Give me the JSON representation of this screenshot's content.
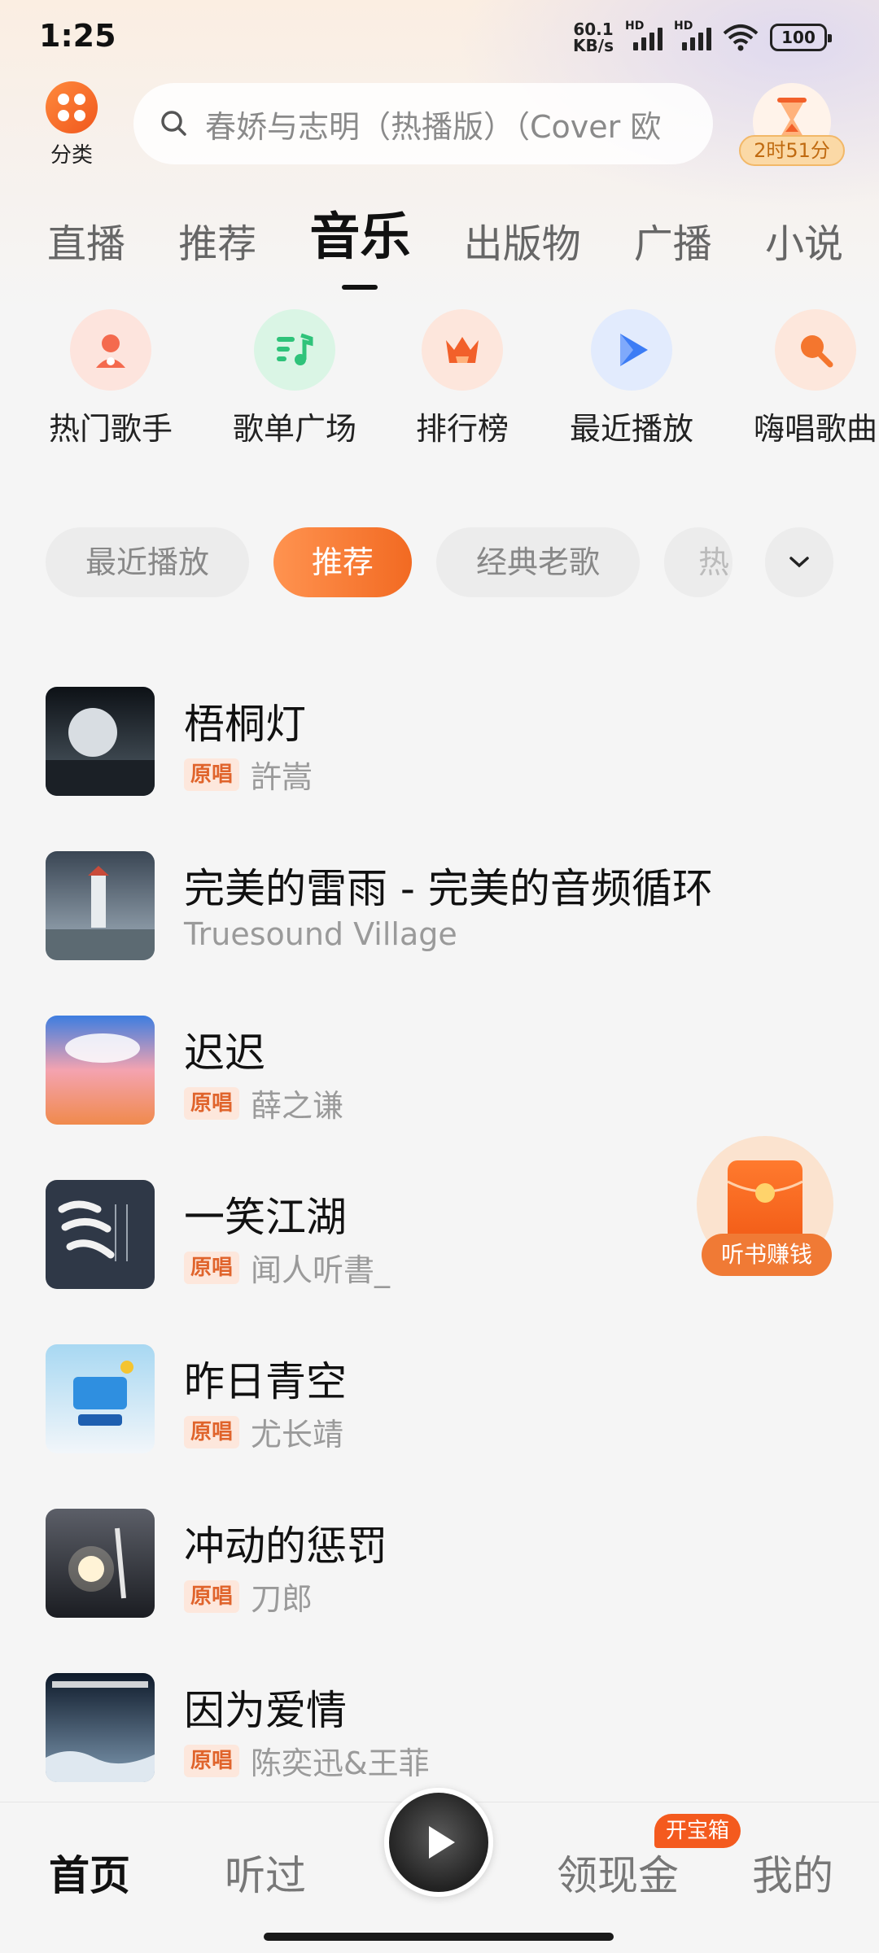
{
  "status_bar": {
    "time": "1:25",
    "net_speed_value": "60.1",
    "net_speed_unit": "KB/s",
    "hd_1": "HD",
    "hd_2": "HD",
    "battery": "100"
  },
  "header": {
    "category_label": "分类",
    "search_placeholder": "春娇与志明（热播版）（Cover 欧",
    "timer_badge": "2时51分"
  },
  "top_tabs": [
    {
      "label": "直播"
    },
    {
      "label": "推荐"
    },
    {
      "label": "音乐",
      "active": true
    },
    {
      "label": "出版物"
    },
    {
      "label": "广播"
    },
    {
      "label": "小说"
    }
  ],
  "quick_entries": [
    {
      "label": "热门歌手",
      "icon": "singer-icon",
      "color": "#f46a4e"
    },
    {
      "label": "歌单广场",
      "icon": "playlist-icon",
      "color": "#2fc37a"
    },
    {
      "label": "排行榜",
      "icon": "crown-icon",
      "color": "#f2602a"
    },
    {
      "label": "最近播放",
      "icon": "play-icon",
      "color": "#3c7cf5"
    },
    {
      "label": "嗨唱歌曲",
      "icon": "search-music-icon",
      "color": "#f4762e"
    }
  ],
  "chips": [
    {
      "label": "最近播放"
    },
    {
      "label": "推荐",
      "active": true
    },
    {
      "label": "经典老歌"
    },
    {
      "label": "热"
    }
  ],
  "songs": [
    {
      "title": "梧桐灯",
      "tag": "原唱",
      "artist": "許嵩",
      "cover_colors": [
        "#0d1116",
        "#53606a"
      ]
    },
    {
      "title": "完美的雷雨 - 完美的音频循环",
      "tag": "",
      "artist": "Truesound Village",
      "cover_colors": [
        "#3a4654",
        "#a7b6c2"
      ]
    },
    {
      "title": "迟迟",
      "tag": "原唱",
      "artist": "薛之谦",
      "cover_colors": [
        "#3d7de0",
        "#f08a4c"
      ]
    },
    {
      "title": "一笑江湖",
      "tag": "原唱",
      "artist": "闻人听書_",
      "cover_colors": [
        "#2f3847",
        "#3b4556"
      ]
    },
    {
      "title": "昨日青空",
      "tag": "原唱",
      "artist": "尤长靖",
      "cover_colors": [
        "#a8d8f2",
        "#f2f6fa"
      ]
    },
    {
      "title": "冲动的惩罚",
      "tag": "原唱",
      "artist": "刀郎",
      "cover_colors": [
        "#1b1d22",
        "#5c5f68"
      ]
    },
    {
      "title": "因为爱情",
      "tag": "原唱",
      "artist": "陈奕迅&王菲",
      "cover_colors": [
        "#0e1a2a",
        "#7f9ab2"
      ]
    }
  ],
  "floating_widget": {
    "label": "听书赚钱"
  },
  "bottom_nav": {
    "home": "首页",
    "listened": "听过",
    "rewards": "领现金",
    "treasure_badge": "开宝箱",
    "mine": "我的"
  },
  "colors": {
    "accent": "#f26a22",
    "tag_bg": "#fde7dc",
    "tag_text": "#e0642c"
  }
}
